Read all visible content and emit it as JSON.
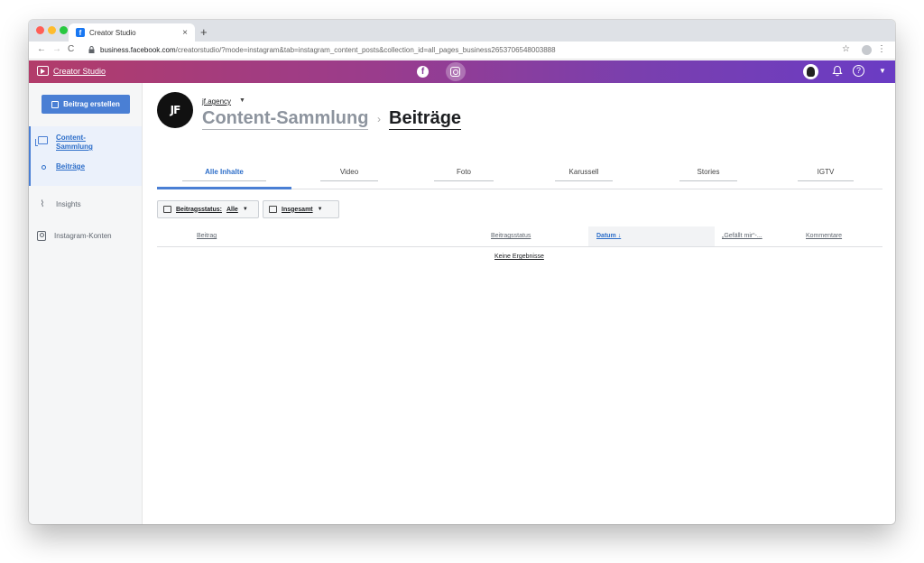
{
  "browser": {
    "tab_title": "Creator Studio",
    "tab_close": "×",
    "new_tab": "+",
    "url_host": "business.facebook.com",
    "url_path": "/creatorstudio/?mode=instagram&tab=instagram_content_posts&collection_id=all_pages_business2653706548003888",
    "nav_back": "←",
    "nav_forward": "→",
    "nav_reload": "C",
    "star": "☆",
    "menu": "⋮"
  },
  "topbar": {
    "title": "Creator Studio",
    "facebook_glyph": "f",
    "bell_glyph": "♫",
    "help_glyph": "?",
    "caret": "▼",
    "gradient_start": "#b23c6a",
    "gradient_end": "#6a3cc4"
  },
  "sidebar": {
    "create_button": "Beitrag erstellen",
    "collection_label": "Content-Sammlung",
    "posts_label": "Beiträge",
    "insights_label": "Insights",
    "accounts_label": "Instagram-Konten",
    "insights_glyph": "⌇"
  },
  "account": {
    "avatar_text": "JF",
    "name": "jf.agency",
    "caret": "▼"
  },
  "breadcrumb": {
    "parent": "Content-Sammlung",
    "separator": "›",
    "current": "Beiträge"
  },
  "tabs": [
    "Alle Inhalte",
    "Video",
    "Foto",
    "Karussell",
    "Stories",
    "IGTV"
  ],
  "filters": {
    "status_label": "Beitragsstatus:",
    "status_value": "Alle",
    "period_value": "Insgesamt",
    "caret": "▼"
  },
  "table": {
    "col_post": "Beitrag",
    "col_status": "Beitragsstatus",
    "col_date": "Datum ↓",
    "col_likes": "„Gefällt mir“-...",
    "col_comments": "Kommentare",
    "empty": "Keine Ergebnisse"
  },
  "colors": {
    "accent": "#4a7fd4",
    "link": "#2d6ec9"
  }
}
